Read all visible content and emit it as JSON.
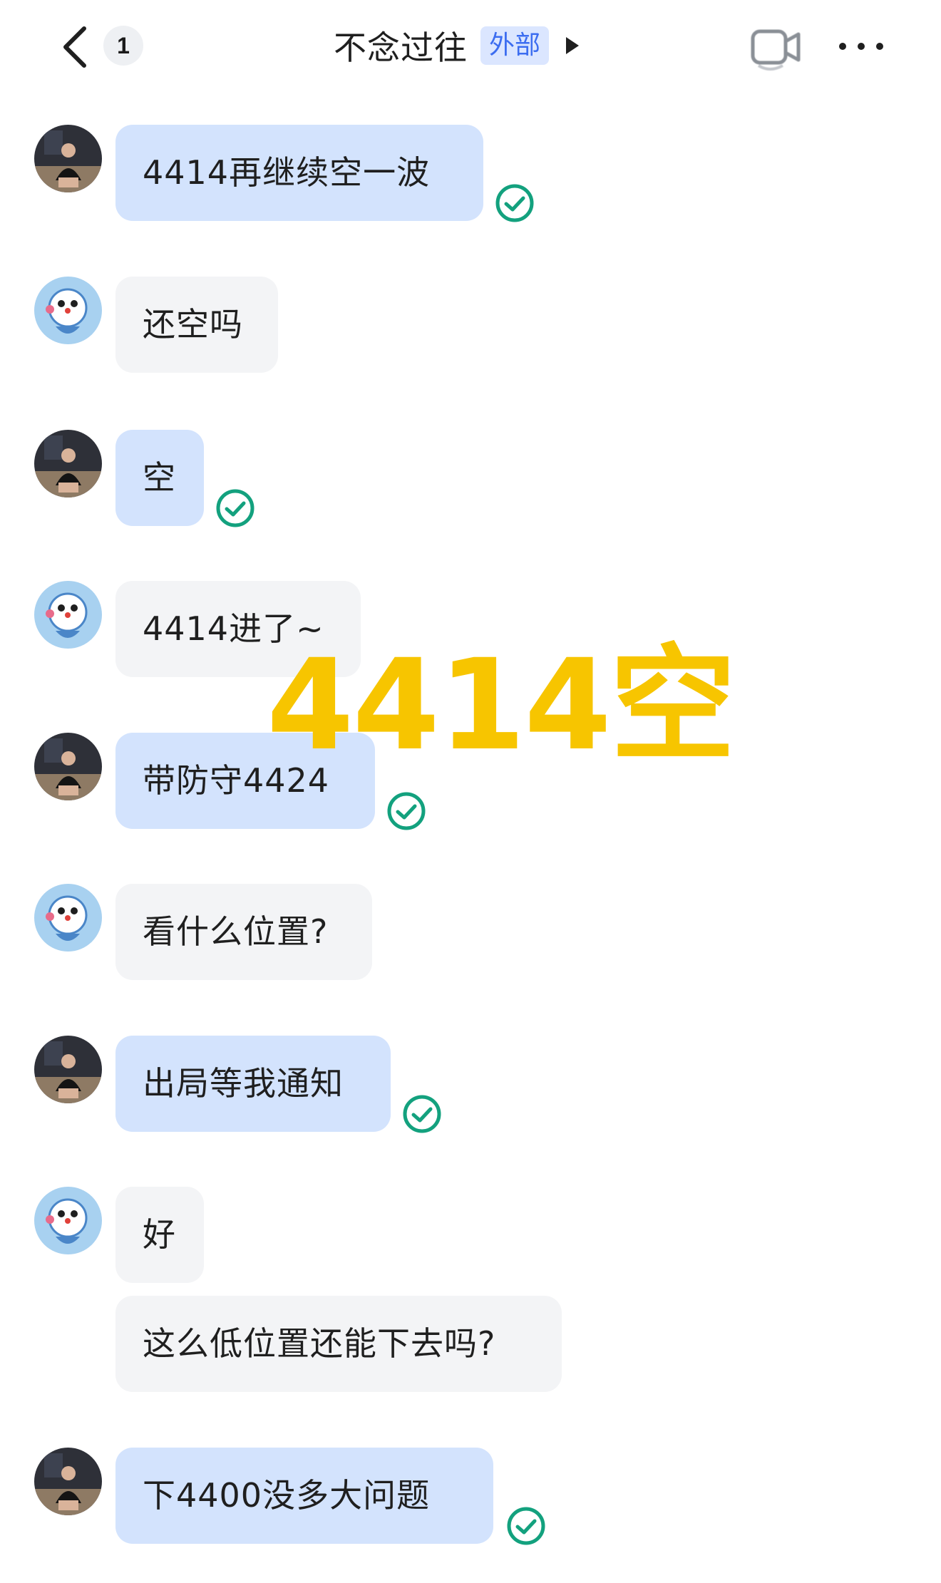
{
  "header": {
    "unread_count": "1",
    "title": "不念过往",
    "tag": "外部"
  },
  "messages": [
    {
      "sender": "me",
      "text": "4414再继续空一波",
      "read": true
    },
    {
      "sender": "other",
      "text": "还空吗"
    },
    {
      "sender": "me",
      "text": "空",
      "read": true
    },
    {
      "sender": "other",
      "text": "4414进了~"
    },
    {
      "sender": "me",
      "text": "带防守4424",
      "read": true
    },
    {
      "sender": "other",
      "text": "看什么位置?"
    },
    {
      "sender": "me",
      "text": "出局等我通知",
      "read": true
    },
    {
      "sender": "other",
      "text": "好"
    },
    {
      "sender": "other",
      "text": "这么低位置还能下去吗?"
    },
    {
      "sender": "me",
      "text": "下4400没多大问题",
      "read": true
    }
  ],
  "watermark": "4414空",
  "colors": {
    "outgoing_bubble": "#d3e3fd",
    "incoming_bubble": "#f3f4f6",
    "read_check": "#13a17e",
    "watermark": "#f7c500",
    "tag_bg": "#dbe6ff",
    "tag_text": "#3c6df0"
  },
  "icons": {
    "back": "chevron-left-icon",
    "video": "video-call-icon",
    "more": "more-dots-icon",
    "read": "read-check-icon",
    "title_arrow": "play-triangle-icon"
  }
}
